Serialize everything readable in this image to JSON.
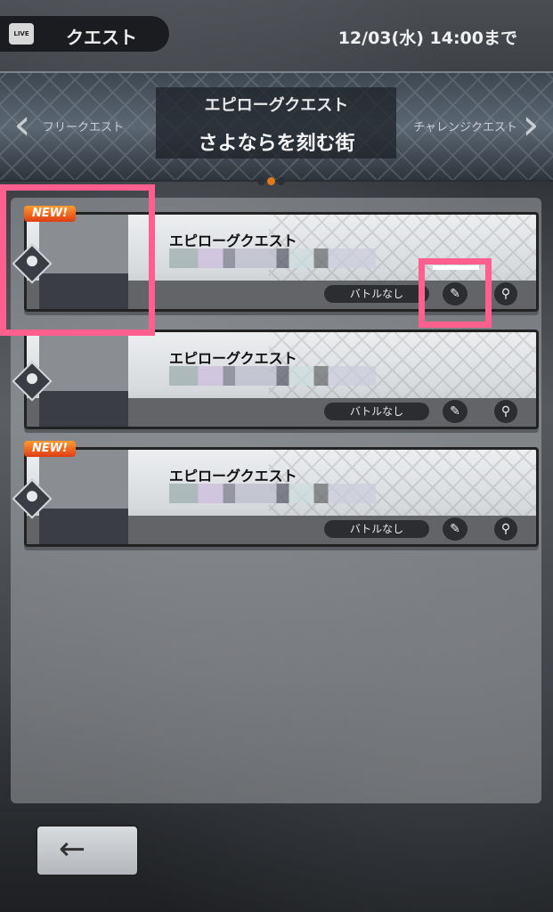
{
  "header": {
    "app_badge": "LIVE",
    "title": "クエスト",
    "deadline": "12/03(水) 14:00まで"
  },
  "banner": {
    "subtitle": "エピローグクエスト",
    "title": "さよならを刻む街",
    "left_label": "フリークエスト",
    "right_label": "チャレンジクエスト",
    "left_arrow": "‹",
    "right_arrow": "›"
  },
  "pager": {
    "count": 3,
    "active_index": 1
  },
  "quests": [
    {
      "title": "エピローグクエスト",
      "badge": "NEW!",
      "battle_label": "バトルなし",
      "tag_icon": "✎",
      "search_icon": "⚲"
    },
    {
      "title": "エピローグクエスト",
      "badge": "",
      "battle_label": "バトルなし",
      "tag_icon": "✎",
      "search_icon": "⚲"
    },
    {
      "title": "エピローグクエスト",
      "badge": "NEW!",
      "battle_label": "バトルなし",
      "tag_icon": "✎",
      "search_icon": "⚲"
    }
  ],
  "back": {
    "arrow": "←"
  },
  "colors": {
    "accent": "#e07a1c",
    "highlight": "#ff5f8f",
    "new_badge": "#e03c14"
  }
}
